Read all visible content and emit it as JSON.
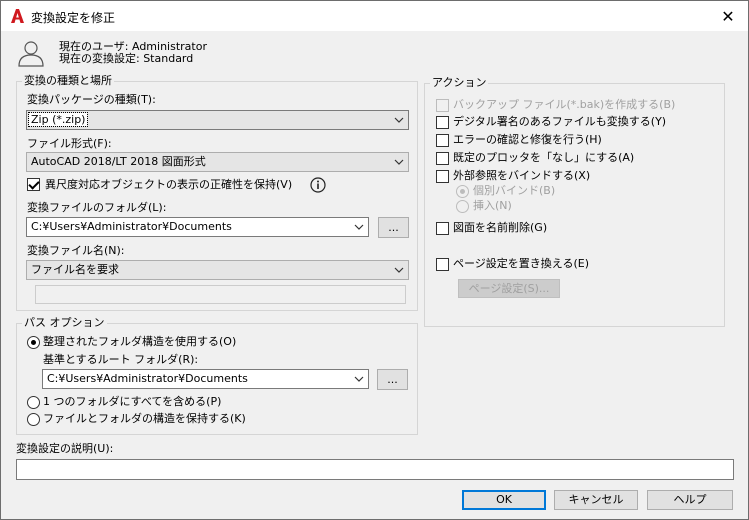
{
  "window": {
    "title": "変換設定を修正",
    "close_symbol": "✕"
  },
  "user": {
    "current_user": "現在のユーザ: Administrator",
    "current_setting": "現在の変換設定: Standard"
  },
  "type_location": {
    "legend": "変換の種類と場所",
    "package_label": "変換パッケージの種類(T):",
    "package_value": "Zip (*.zip)",
    "format_label": "ファイル形式(F):",
    "format_value": "AutoCAD 2018/LT 2018 図面形式",
    "preserve_label": "異尺度対応オブジェクトの表示の正確性を保持(V)",
    "folder_label": "変換ファイルのフォルダ(L):",
    "folder_value": "C:¥Users¥Administrator¥Documents",
    "browse_label": "...",
    "filename_label": "変換ファイル名(N):",
    "filename_value": "ファイル名を要求"
  },
  "path_options": {
    "legend": "パス オプション",
    "organized_label": "整理されたフォルダ構造を使用する(O)",
    "root_label": "基準とするルート フォルダ(R):",
    "root_value": "C:¥Users¥Administrator¥Documents",
    "browse_label": "...",
    "single_folder_label": "1 つのフォルダにすべてを含める(P)",
    "keep_structure_label": "ファイルとフォルダの構造を保持する(K)"
  },
  "actions": {
    "legend": "アクション",
    "backup_label": "バックアップ ファイル(*.bak)を作成する(B)",
    "signed_label": "デジタル署名のあるファイルも変換する(Y)",
    "audit_label": "エラーの確認と修復を行う(H)",
    "plotter_label": "既定のプロッタを「なし」にする(A)",
    "bind_label": "外部参照をバインドする(X)",
    "bind_option": "個別バインド(B)",
    "insert_option": "挿入(N)",
    "purge_label": "図面を名前削除(G)",
    "page_setup_label": "ページ設定を置き換える(E)",
    "page_setup_button": "ページ設定(S)..."
  },
  "description": {
    "label": "変換設定の説明(U):",
    "value": ""
  },
  "buttons": {
    "ok": "OK",
    "cancel": "キャンセル",
    "help": "ヘルプ"
  },
  "colors": {
    "accent": "#0078d7",
    "app_icon": "#d0191f"
  }
}
